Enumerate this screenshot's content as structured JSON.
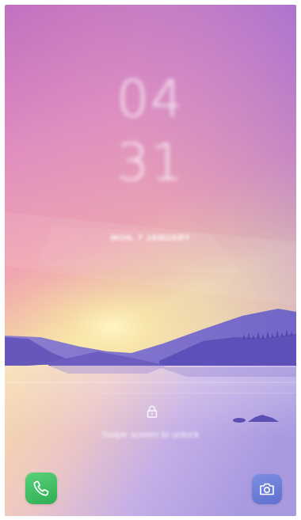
{
  "lockscreen": {
    "clock_hours": "04",
    "clock_minutes": "31",
    "date": "MON, 7 JANUARY",
    "unlock_hint": "Swipe screen to unlock"
  },
  "shortcuts": {
    "phone_icon": "phone-icon",
    "camera_icon": "camera-icon"
  },
  "colors": {
    "sky_top": "#c87bc0",
    "sky_mid": "#e59bb0",
    "horizon_glow": "#f6e9a8",
    "mountain_purple": "#6a5cc0",
    "water_lavender": "#b9a6e4",
    "phone_green": "#3fbe63",
    "camera_blue": "#6b7ddb"
  }
}
